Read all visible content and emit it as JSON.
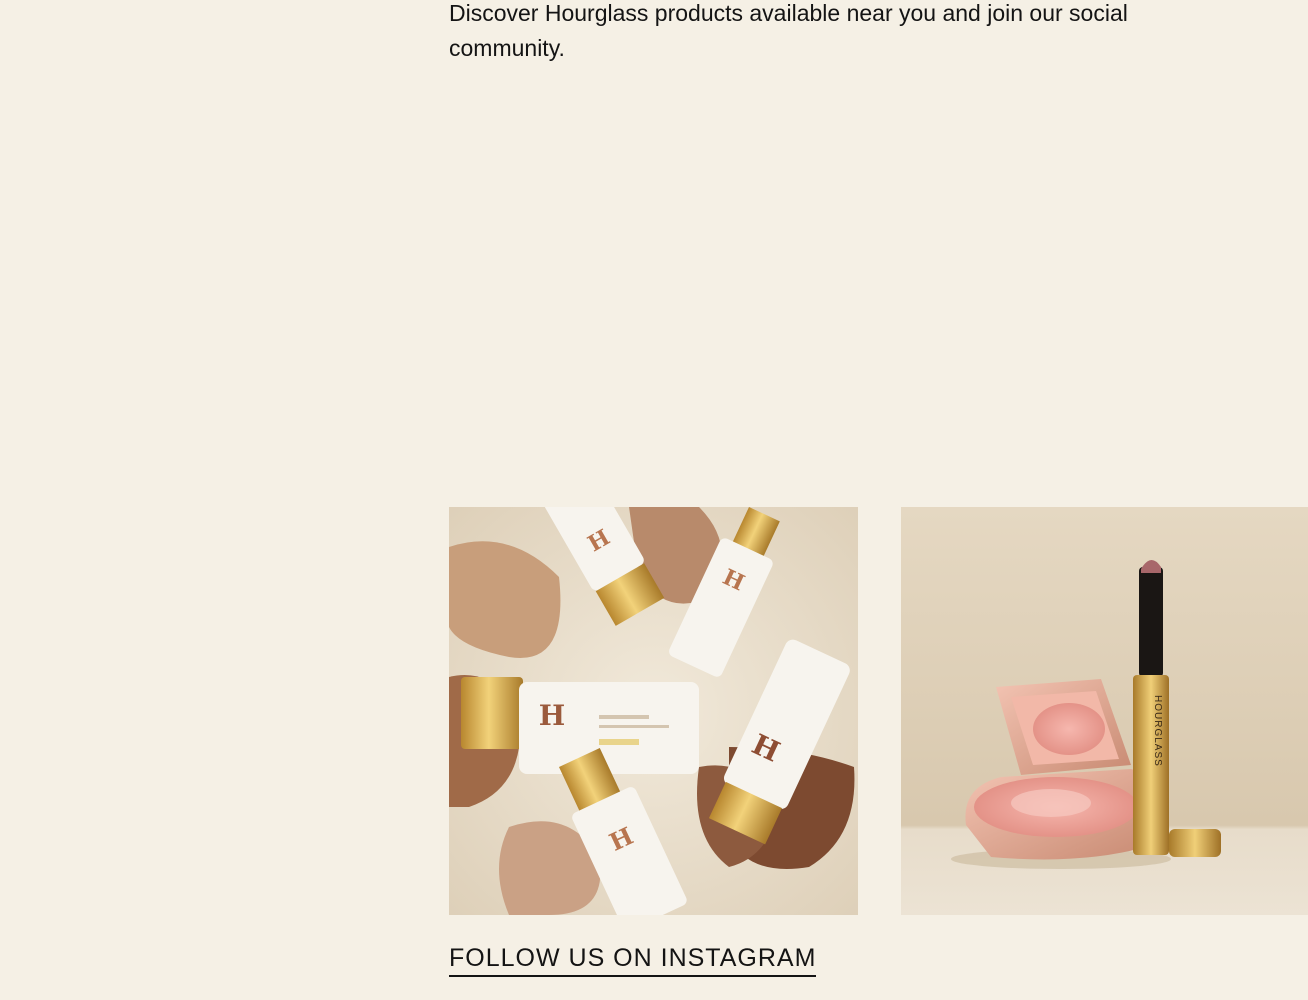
{
  "intro": {
    "text": "Discover Hourglass products available near you and join our social community."
  },
  "gallery": {
    "tiles": [
      {
        "name": "foundation-tubes-photo",
        "description_icon": "product-photo"
      },
      {
        "name": "blush-lipstick-photo",
        "description_icon": "product-photo"
      }
    ],
    "lipstick_brand_text": "HOURGLASS"
  },
  "social": {
    "instagram_link_label": "FOLLOW US ON INSTAGRAM"
  },
  "colors": {
    "background": "#f5f0e5",
    "text": "#141414",
    "gold": "#d4a94a",
    "tube_white": "#f7f4ee",
    "swatch_tan": "#c89e7b",
    "swatch_brown": "#8d5a3e",
    "blush_pink": "#e89a8e"
  }
}
